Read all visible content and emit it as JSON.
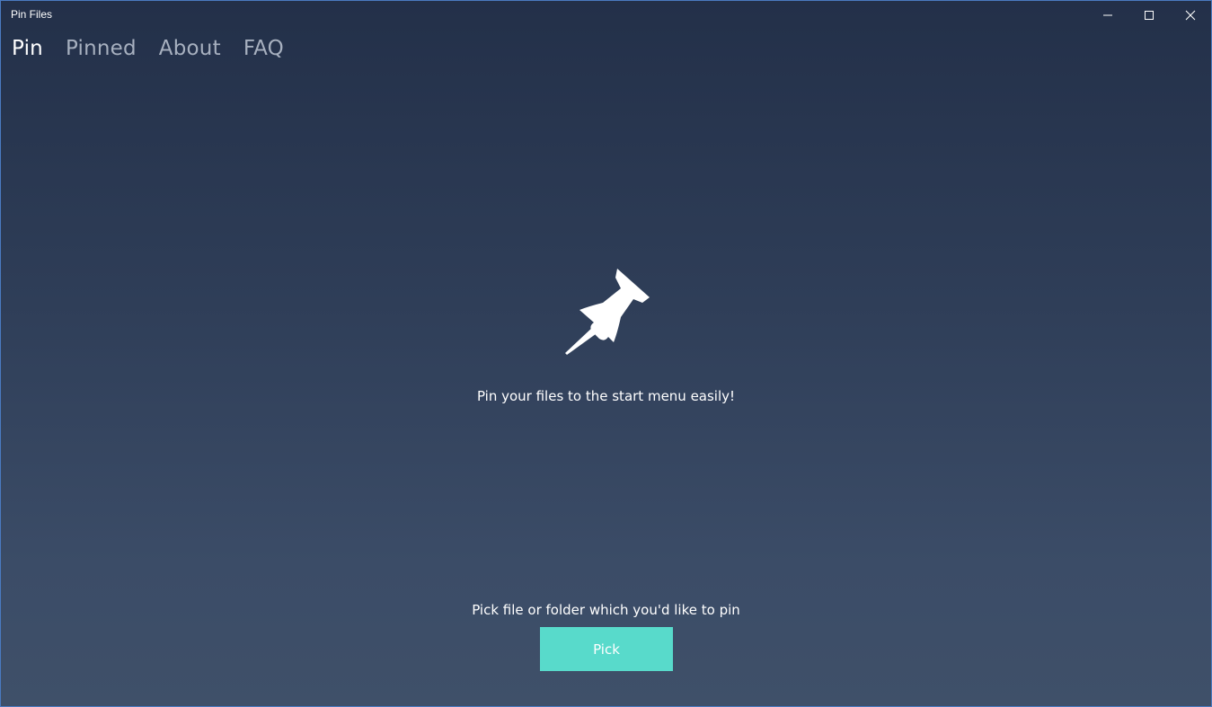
{
  "window": {
    "title": "Pin Files",
    "caption_buttons": [
      {
        "name": "minimize-icon"
      },
      {
        "name": "maximize-icon"
      },
      {
        "name": "close-icon"
      }
    ]
  },
  "nav": {
    "tabs": [
      {
        "label": "Pin",
        "active": true
      },
      {
        "label": "Pinned",
        "active": false
      },
      {
        "label": "About",
        "active": false
      },
      {
        "label": "FAQ",
        "active": false
      }
    ]
  },
  "main": {
    "icon": "pushpin-icon",
    "tagline": "Pin your files to the start menu easily!",
    "pick_prompt": "Pick file or folder which you'd like to pin",
    "pick_button_label": "Pick"
  },
  "colors": {
    "accent": "#58dacb",
    "background_top": "#233049",
    "background_bottom": "#3f5069",
    "inactive_tab": "#a7b0bf"
  }
}
